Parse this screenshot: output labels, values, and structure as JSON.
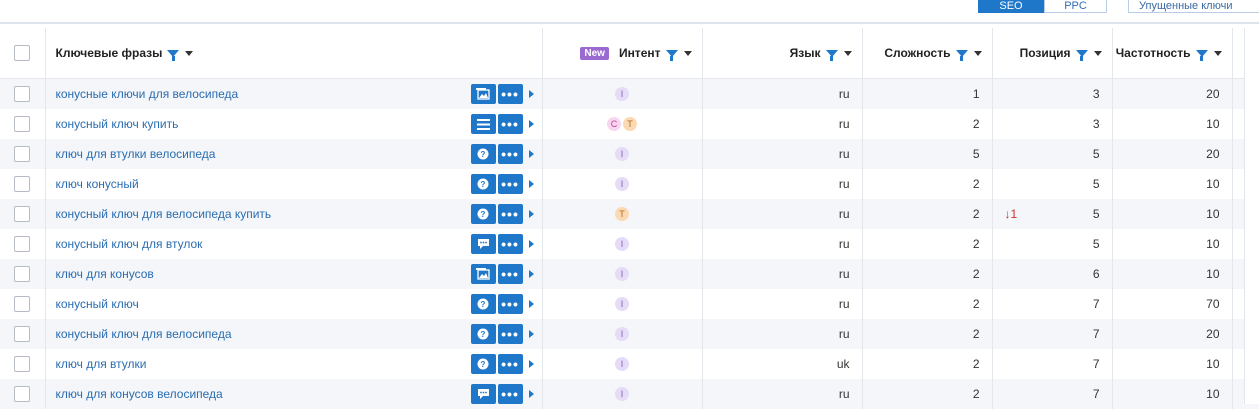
{
  "mode_tabs": {
    "seo": "SEO",
    "ppc": "PPC",
    "lost": "Упущенные ключи"
  },
  "columns": {
    "keyword": "Ключевые фразы",
    "new_badge": "New",
    "intent": "Интент",
    "language": "Язык",
    "difficulty": "Сложность",
    "position": "Позиция",
    "frequency": "Частотность"
  },
  "accent_color": "#1f77c9",
  "rows": [
    {
      "keyword": "конусные ключи для велосипеда",
      "serp_icon": "image-pack-icon",
      "intent": [
        "I"
      ],
      "lang": "ru",
      "difficulty": "1",
      "change": "",
      "position": "3",
      "frequency": "20"
    },
    {
      "keyword": "конусный ключ купить",
      "serp_icon": "list-icon",
      "intent": [
        "C",
        "T"
      ],
      "lang": "ru",
      "difficulty": "2",
      "change": "",
      "position": "3",
      "frequency": "10"
    },
    {
      "keyword": "ключ для втулки велосипеда",
      "serp_icon": "question-icon",
      "intent": [
        "I"
      ],
      "lang": "ru",
      "difficulty": "5",
      "change": "",
      "position": "5",
      "frequency": "20"
    },
    {
      "keyword": "ключ конусный",
      "serp_icon": "question-icon",
      "intent": [
        "I"
      ],
      "lang": "ru",
      "difficulty": "2",
      "change": "",
      "position": "5",
      "frequency": "10"
    },
    {
      "keyword": "конусный ключ для велосипеда купить",
      "serp_icon": "question-icon",
      "intent": [
        "T"
      ],
      "lang": "ru",
      "difficulty": "2",
      "change": "1",
      "position": "5",
      "frequency": "10"
    },
    {
      "keyword": "конусный ключ для втулок",
      "serp_icon": "review-icon",
      "intent": [
        "I"
      ],
      "lang": "ru",
      "difficulty": "2",
      "change": "",
      "position": "5",
      "frequency": "10"
    },
    {
      "keyword": "ключ для конусов",
      "serp_icon": "image-pack-icon",
      "intent": [
        "I"
      ],
      "lang": "ru",
      "difficulty": "2",
      "change": "",
      "position": "6",
      "frequency": "10"
    },
    {
      "keyword": "конусный ключ",
      "serp_icon": "question-icon",
      "intent": [
        "I"
      ],
      "lang": "ru",
      "difficulty": "2",
      "change": "",
      "position": "7",
      "frequency": "70"
    },
    {
      "keyword": "конусный ключ для велосипеда",
      "serp_icon": "question-icon",
      "intent": [
        "I"
      ],
      "lang": "ru",
      "difficulty": "2",
      "change": "",
      "position": "7",
      "frequency": "20"
    },
    {
      "keyword": "ключ для втулки",
      "serp_icon": "question-icon",
      "intent": [
        "I"
      ],
      "lang": "uk",
      "difficulty": "2",
      "change": "",
      "position": "7",
      "frequency": "10"
    },
    {
      "keyword": "ключ для конусов велосипеда",
      "serp_icon": "review-icon",
      "intent": [
        "I"
      ],
      "lang": "ru",
      "difficulty": "2",
      "change": "",
      "position": "7",
      "frequency": "10"
    }
  ]
}
